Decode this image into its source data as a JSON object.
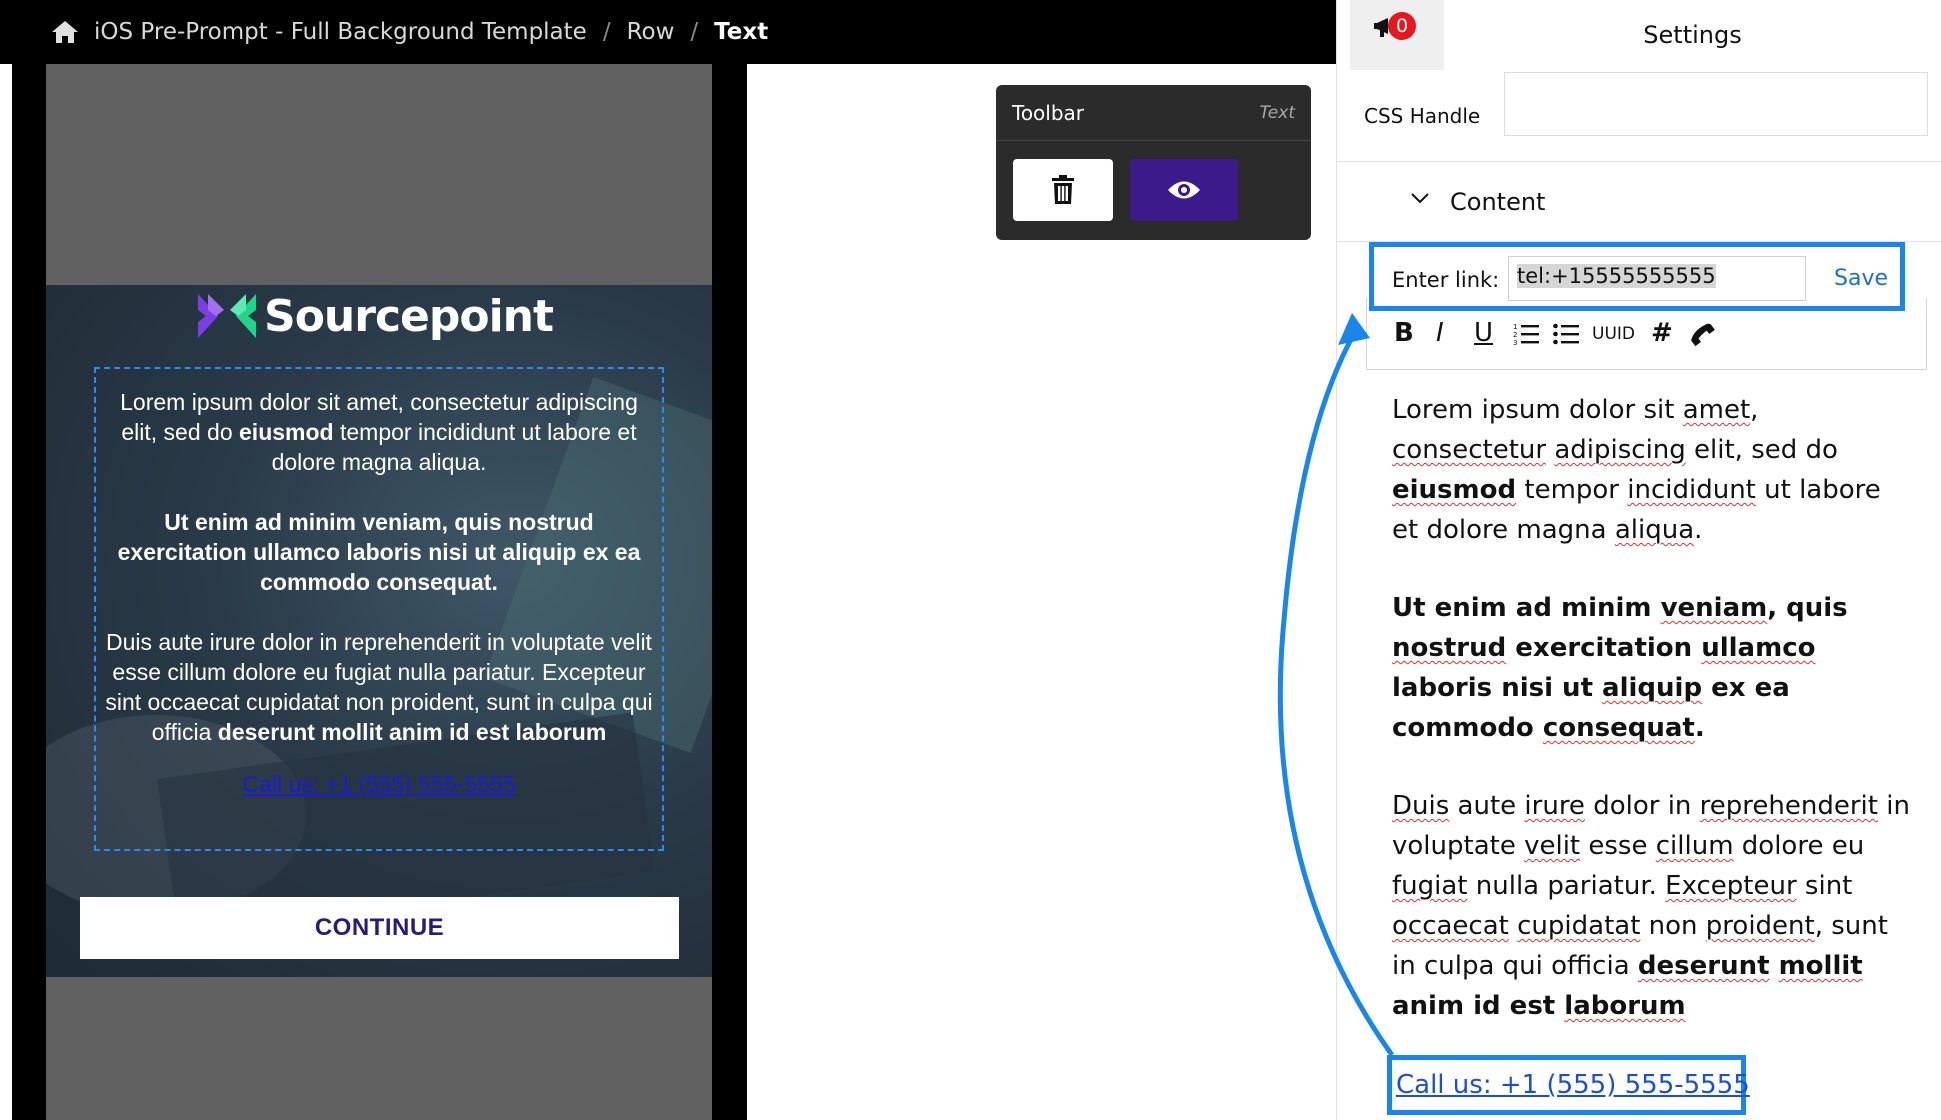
{
  "breadcrumb": {
    "items": [
      "iOS Pre-Prompt - Full Background Template",
      "Row"
    ],
    "current": "Text",
    "separator": "/"
  },
  "preview": {
    "logo_text": "Sourcepoint",
    "para1_a": "Lorem ipsum dolor sit amet, consectetur adipiscing elit, sed do ",
    "para1_bold": "eiusmod",
    "para1_b": " tempor incididunt ut labore et dolore magna aliqua.",
    "para2": "Ut enim ad minim veniam, quis nostrud exercitation ullamco laboris nisi ut aliquip ex ea commodo consequat.",
    "para3_a": "Duis aute irure dolor in reprehenderit in voluptate velit esse cillum dolore eu fugiat nulla pariatur. Excepteur sint occaecat cupidatat non proident, sunt in culpa qui officia ",
    "para3_bold": "deserunt mollit anim id est laborum",
    "call_link": "Call us: +1 (555) 555-5555",
    "continue_button": "CONTINUE"
  },
  "toolbar": {
    "title": "Toolbar",
    "element_type": "Text",
    "delete_icon": "trash-icon",
    "preview_icon": "eye-icon"
  },
  "settings": {
    "title": "Settings",
    "notification_count": "0",
    "css_handle_label": "CSS Handle",
    "css_handle_value": "",
    "content_section_label": "Content"
  },
  "link_editor": {
    "label": "Enter link:",
    "value": "tel:+15555555555",
    "save_label": "Save"
  },
  "format_toolbar": {
    "bold": "B",
    "italic": "I",
    "underline": "U",
    "uuid": "UUID",
    "hash": "#"
  },
  "editor": {
    "p1_w1": "Lorem ipsum dolor sit ",
    "p1_s1": "amet",
    "p1_w2": ", ",
    "p1_s2": "consectetur",
    "p1_w3": " ",
    "p1_s3": "adipiscing",
    "p1_w4": " elit, sed do ",
    "p1_bold": "eiusmod",
    "p1_w5": " tempor ",
    "p1_s4": "incididunt",
    "p1_w6": " ut labore et dolore magna ",
    "p1_s5": "aliqua",
    "p1_w7": ".",
    "p2_a": "Ut enim ad minim ",
    "p2_s1": "veniam",
    "p2_b": ", quis ",
    "p2_s2": "nostrud",
    "p2_c": " exercitation ",
    "p2_s3": "ullamco",
    "p2_d": " laboris nisi ut ",
    "p2_s4": "aliquip",
    "p2_e": " ex ea commodo ",
    "p2_s5": "consequat",
    "p2_f": ".",
    "p3_s1": "Duis",
    "p3_a": " aute ",
    "p3_s2": "irure",
    "p3_b": " dolor in ",
    "p3_s3": "reprehenderit",
    "p3_c": " in voluptate ",
    "p3_s4": "velit",
    "p3_d": " esse ",
    "p3_s5": "cillum",
    "p3_e": " dolore eu ",
    "p3_s6": "fugiat",
    "p3_f": " nulla pariatur. ",
    "p3_s7": "Excepteur",
    "p3_g": " sint ",
    "p3_s8": "occaecat",
    "p3_h": " ",
    "p3_s9": "cupidatat",
    "p3_i": " non ",
    "p3_s10": "proident",
    "p3_j": ", sunt in culpa qui officia ",
    "p3_bold1": "deserunt",
    "p3_bold2": " ",
    "p3_s11": "mollit",
    "p3_bold3": " anim id est ",
    "p3_s12": "laborum",
    "call_link": "Call us: +1 (555) 555-5555"
  },
  "colors": {
    "accent_blue": "#1a86e8",
    "preview_button_purple": "#3b1a8c",
    "badge_red": "#e8161e"
  }
}
